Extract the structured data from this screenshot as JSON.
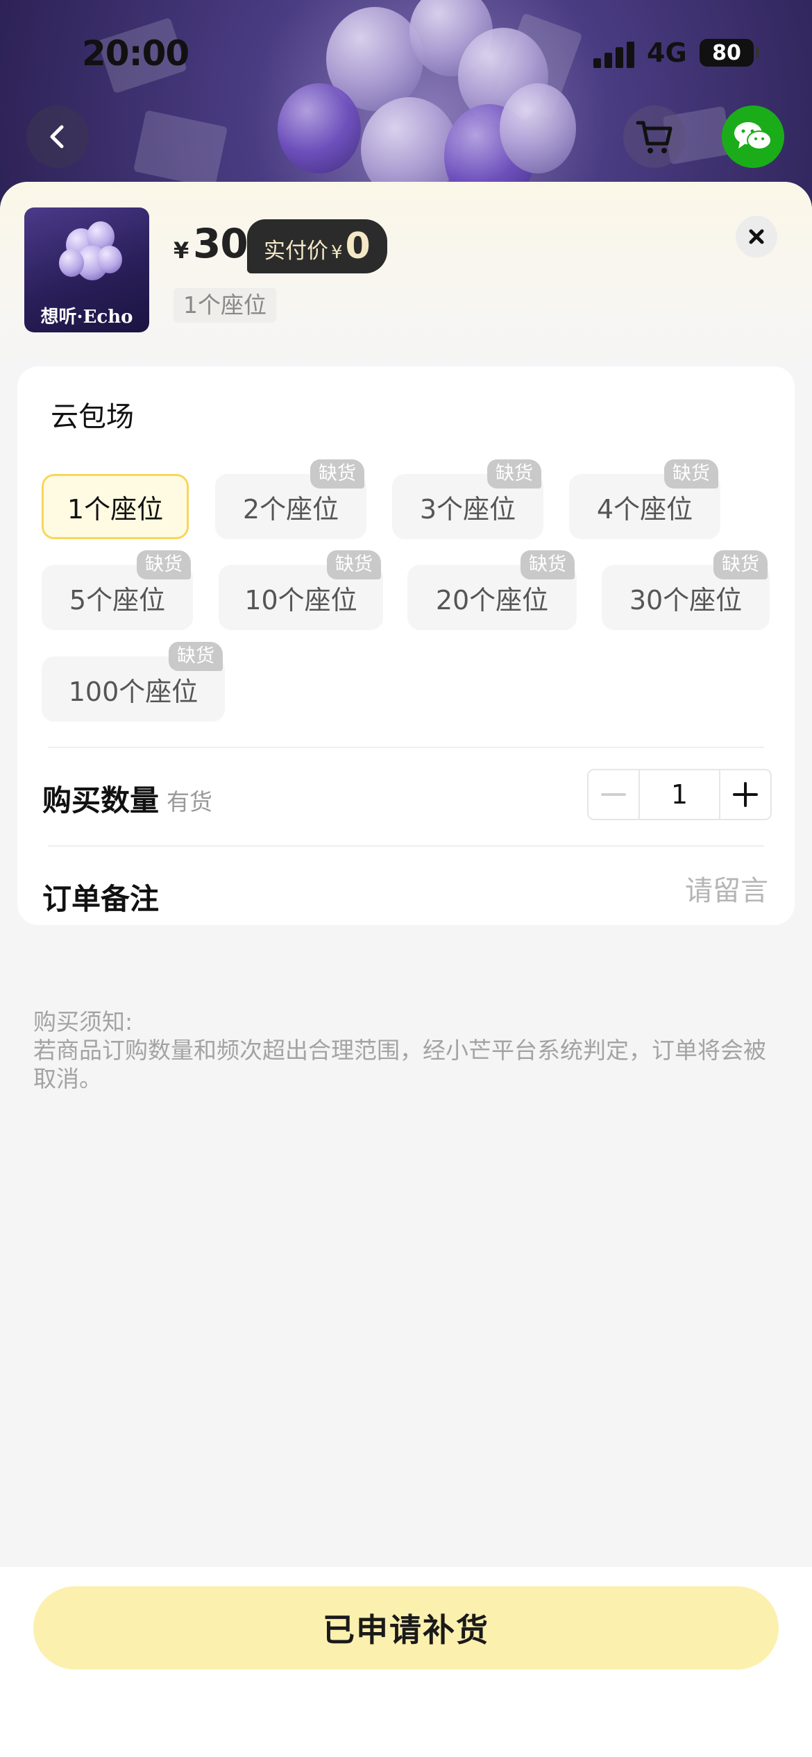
{
  "status_bar": {
    "time": "20:00",
    "network": "4G",
    "battery": "80"
  },
  "product": {
    "thumbnail_label": "想听·Echo",
    "currency": "¥",
    "price": "30",
    "paid_label": "实付价",
    "paid_currency": "¥",
    "paid_value": "0",
    "selected_spec": "1个座位"
  },
  "spec": {
    "title": "云包场",
    "stock_badge": "缺货",
    "options": [
      {
        "label": "1个座位",
        "selected": true,
        "out_of_stock": false
      },
      {
        "label": "2个座位",
        "selected": false,
        "out_of_stock": true
      },
      {
        "label": "3个座位",
        "selected": false,
        "out_of_stock": true
      },
      {
        "label": "4个座位",
        "selected": false,
        "out_of_stock": true
      },
      {
        "label": "5个座位",
        "selected": false,
        "out_of_stock": true
      },
      {
        "label": "10个座位",
        "selected": false,
        "out_of_stock": true
      },
      {
        "label": "20个座位",
        "selected": false,
        "out_of_stock": true
      },
      {
        "label": "30个座位",
        "selected": false,
        "out_of_stock": true
      },
      {
        "label": "100个座位",
        "selected": false,
        "out_of_stock": true
      }
    ]
  },
  "quantity": {
    "label": "购买数量",
    "stock_status": "有货",
    "value": "1"
  },
  "order_note": {
    "label": "订单备注",
    "placeholder": "请留言"
  },
  "notice": {
    "title": "购买须知:",
    "text": "若商品订购数量和频次超出合理范围，经小芒平台系统判定，订单将会被取消。"
  },
  "action": {
    "label": "已申请补货"
  },
  "colors": {
    "accent_yellow": "#fcf0ae",
    "selected_border": "#f7d65a",
    "badge_grey": "#c9c9c9",
    "wechat_green": "#1aad19"
  }
}
